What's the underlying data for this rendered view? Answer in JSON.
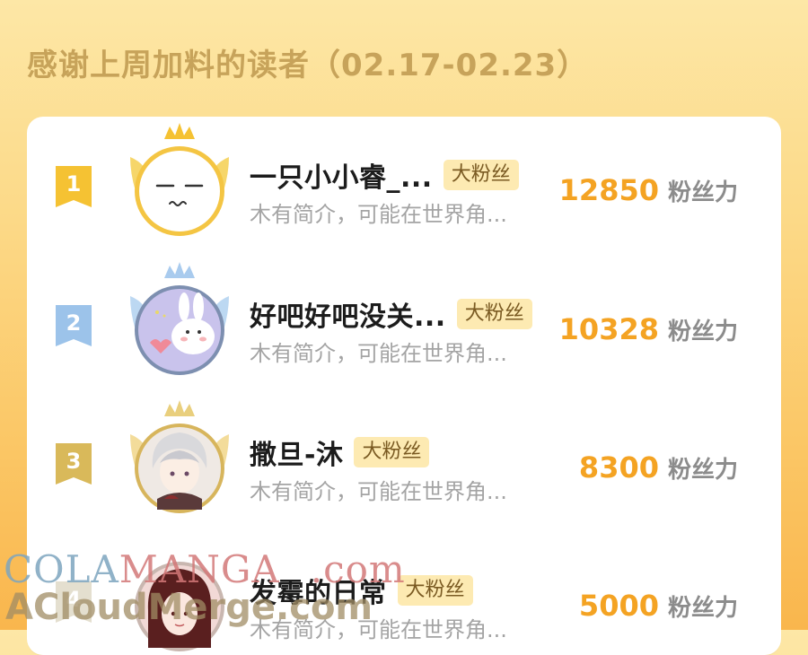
{
  "header": {
    "title": "感谢上周加料的读者（02.17-02.23）"
  },
  "colors": {
    "accent": "#f4a323",
    "tag_bg": "#fdeab2",
    "rank1": "#f5c233",
    "rank2": "#9cc3ea",
    "rank3": "#d9b95a"
  },
  "list": {
    "rows": [
      {
        "rank": "1",
        "name": "一只小小睿_...",
        "tag": "大粉丝",
        "bio": "木有简介，可能在世界角...",
        "score": "12850",
        "unit": "粉丝力",
        "avatar_icon": "sleepy-face-avatar"
      },
      {
        "rank": "2",
        "name": "好吧好吧没关...",
        "tag": "大粉丝",
        "bio": "木有简介，可能在世界角...",
        "score": "10328",
        "unit": "粉丝力",
        "avatar_icon": "bunny-avatar"
      },
      {
        "rank": "3",
        "name": "撒旦-沐",
        "tag": "大粉丝",
        "bio": "木有简介，可能在世界角...",
        "score": "8300",
        "unit": "粉丝力",
        "avatar_icon": "anime-boy-avatar"
      },
      {
        "rank": "4",
        "name": "发霉的日常",
        "tag": "大粉丝",
        "bio": "木有简介，可能在世界角...",
        "score": "5000",
        "unit": "粉丝力",
        "avatar_icon": "anime-girl-avatar"
      }
    ]
  },
  "watermark": {
    "line1_a": "COLA",
    "line1_b": "MANGA",
    "line1_c": ".com",
    "line2": "ACloudMerge.com"
  }
}
